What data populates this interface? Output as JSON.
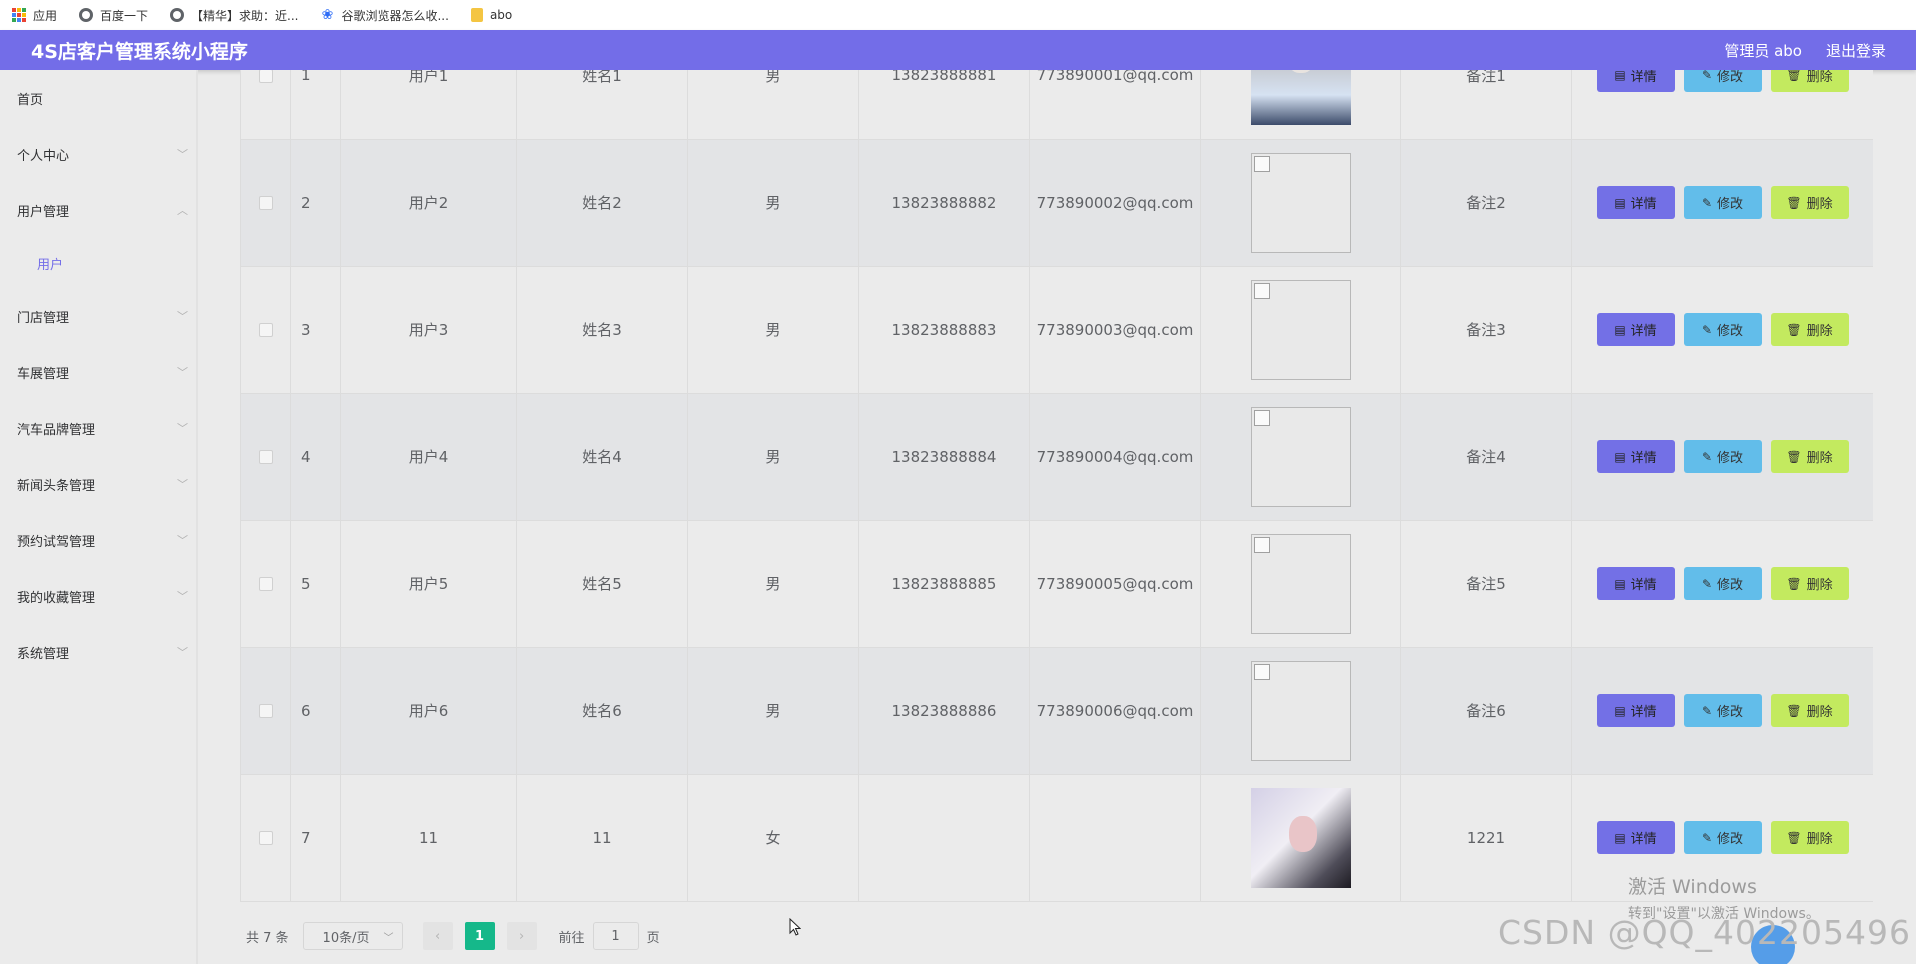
{
  "bookmarks": [
    {
      "label": "应用",
      "icon": "apps-icon"
    },
    {
      "label": "百度一下",
      "icon": "globe-icon"
    },
    {
      "label": "【精华】求助：近...",
      "icon": "globe-icon"
    },
    {
      "label": "谷歌浏览器怎么收...",
      "icon": "baidu-paw-icon"
    },
    {
      "label": "abo",
      "icon": "folder-icon"
    }
  ],
  "header": {
    "title": "4S店客户管理系统小程序",
    "user": "管理员 abo",
    "logout": "退出登录",
    "bg_color": "#736de8"
  },
  "sidebar": {
    "items": [
      {
        "label": "首页",
        "chevron": ""
      },
      {
        "label": "个人中心",
        "chevron": "﹀"
      },
      {
        "label": "用户管理",
        "chevron": "︿"
      },
      {
        "label": "门店管理",
        "chevron": "﹀"
      },
      {
        "label": "车展管理",
        "chevron": "﹀"
      },
      {
        "label": "汽车品牌管理",
        "chevron": "﹀"
      },
      {
        "label": "新闻头条管理",
        "chevron": "﹀"
      },
      {
        "label": "预约试驾管理",
        "chevron": "﹀"
      },
      {
        "label": "我的收藏管理",
        "chevron": "﹀"
      },
      {
        "label": "系统管理",
        "chevron": "﹀"
      }
    ],
    "sub_item": "用户"
  },
  "table": {
    "rows": [
      {
        "index": "1",
        "account": "用户1",
        "name": "姓名1",
        "gender": "男",
        "phone": "13823888881",
        "email": "773890001@qq.com",
        "photo": "photo-a",
        "remark": "备注1"
      },
      {
        "index": "2",
        "account": "用户2",
        "name": "姓名2",
        "gender": "男",
        "phone": "13823888882",
        "email": "773890002@qq.com",
        "photo": "broken",
        "remark": "备注2"
      },
      {
        "index": "3",
        "account": "用户3",
        "name": "姓名3",
        "gender": "男",
        "phone": "13823888883",
        "email": "773890003@qq.com",
        "photo": "broken",
        "remark": "备注3"
      },
      {
        "index": "4",
        "account": "用户4",
        "name": "姓名4",
        "gender": "男",
        "phone": "13823888884",
        "email": "773890004@qq.com",
        "photo": "broken",
        "remark": "备注4"
      },
      {
        "index": "5",
        "account": "用户5",
        "name": "姓名5",
        "gender": "男",
        "phone": "13823888885",
        "email": "773890005@qq.com",
        "photo": "broken",
        "remark": "备注5"
      },
      {
        "index": "6",
        "account": "用户6",
        "name": "姓名6",
        "gender": "男",
        "phone": "13823888886",
        "email": "773890006@qq.com",
        "photo": "broken",
        "remark": "备注6"
      },
      {
        "index": "7",
        "account": "11",
        "name": "11",
        "gender": "女",
        "phone": "",
        "email": "",
        "photo": "photo-b",
        "remark": "1221"
      }
    ],
    "actions": {
      "detail": "详情",
      "edit": "修改",
      "delete": "删除"
    }
  },
  "pagination": {
    "total": "共 7 条",
    "page_size": "10条/页",
    "current_page": "1",
    "goto_prefix": "前往",
    "goto_value": "1",
    "goto_suffix": "页"
  },
  "overlay": {
    "win_activate_title": "激活 Windows",
    "win_activate_hint": "转到\"设置\"以激活 Windows。",
    "watermark": "CSDN @QQ_402205496"
  }
}
